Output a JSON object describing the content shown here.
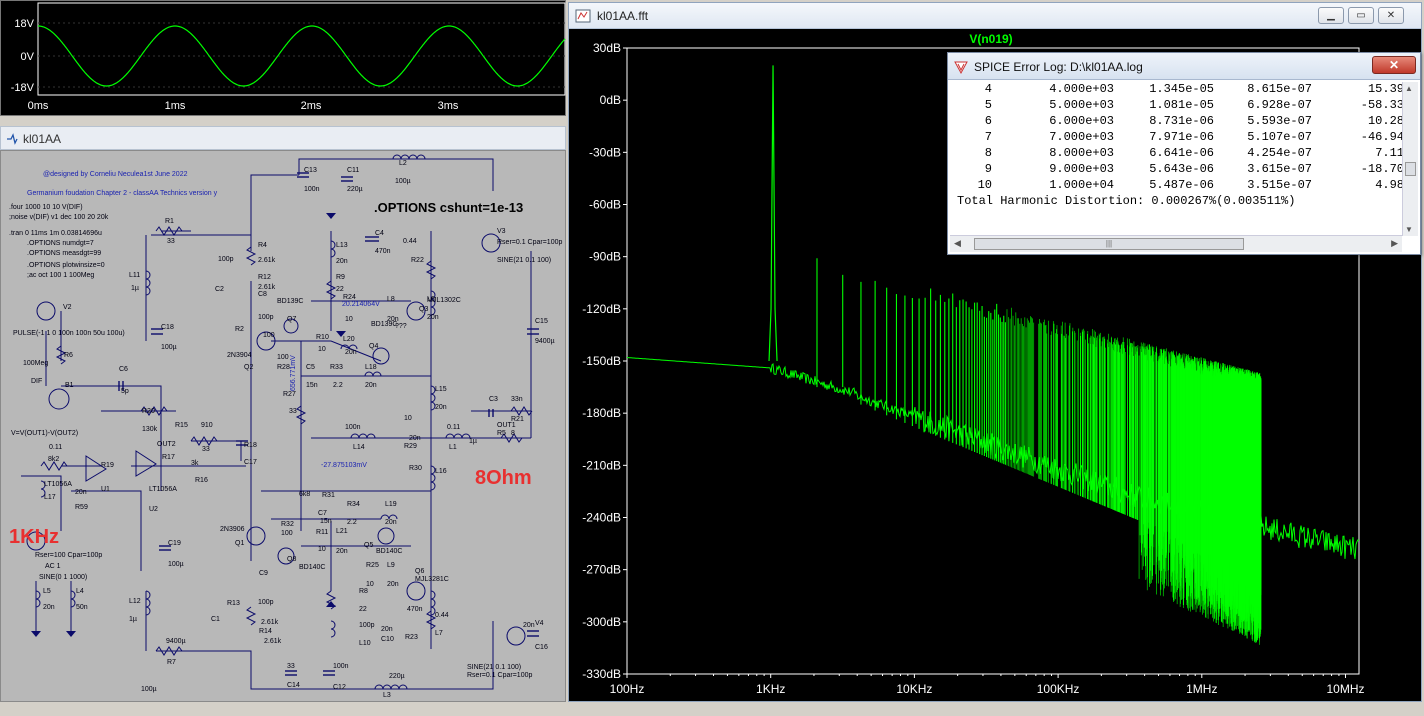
{
  "waveform": {
    "y_labels": [
      "18V",
      "0V",
      "-18V"
    ],
    "x_labels": [
      "0ms",
      "1ms",
      "2ms",
      "3ms"
    ]
  },
  "schematic": {
    "title": "kl01AA",
    "header_lines": [
      "@designed by Corneliu Neculea1st June 2022",
      "Germanium foudation Chapter 2 - classAA Technics version y"
    ],
    "directives": [
      ".four 1000 10 10 V(DIF)",
      ";noise v(DIF) v1 dec 100 20 20k",
      ".tran 0 11ms 1m 0.03814696u",
      ".OPTIONS numdgt=7",
      ".OPTIONS measdgt=99",
      ".OPTIONS plotwinsize=0",
      ";ac oct 100 1 100Meg"
    ],
    "options_big": ".OPTIONS cshunt=1e-13",
    "label_8ohm": "8Ohm",
    "label_1khz": "1KHz",
    "pulse": "PULSE(-1 1 0 100n 100n 50u 100u)",
    "dif_expr": "V=V(OUT1)-V(OUT2)",
    "src_bottom_left": [
      "Rser=100 Cpar=100p",
      "AC 1",
      "SINE(0 1 1000)"
    ],
    "src_v3": [
      "Rser=0.1 Cpar=100p",
      "SINE(21 0.1 100)"
    ],
    "src_v4": [
      "SINE(21 0.1 100)",
      "Rser=0.1 Cpar=100p"
    ],
    "node_voltage_1": "20.214064V",
    "node_voltage_2": "-27.875103mV",
    "node_voltage_3": "656.771mV",
    "labels": [
      "C13",
      "100n",
      "C11",
      "220µ",
      "L2",
      "100µ",
      "R1",
      "33",
      "R4",
      "2.61k",
      "R12",
      "2.61k",
      "L13",
      "20n",
      "C4",
      "470n",
      "0.44",
      "R22",
      "V3",
      "L11",
      "1µ",
      "C2",
      "100p",
      "C8",
      "100p",
      "R9",
      "22",
      "R24",
      "10",
      "L8",
      "20n",
      "L6",
      "20n",
      "MJL1302C",
      "BD139C",
      "BD139C",
      "???",
      "Q3",
      "Q7",
      "V2",
      "C18",
      "100µ",
      "R2",
      "100",
      "Q2",
      "2N3904",
      "R10",
      "10",
      "L20",
      "20n",
      "Q4",
      "C15",
      "9400µ",
      "R6",
      "100Meg",
      "DIF",
      "B1",
      "C6",
      "5p",
      "R28",
      "100",
      "C5",
      "15n",
      "R33",
      "2.2",
      "L18",
      "20n",
      "R27",
      "33",
      "L15",
      "20n",
      "R20",
      "130k",
      "R15",
      "910",
      "C3",
      "33n",
      "R21",
      "10",
      "0.11",
      "L1",
      "1µ",
      "OUT1",
      "R5",
      "8",
      "OUT2",
      "R17",
      "3k",
      "R16",
      "33",
      "R18",
      "C17",
      "100n",
      "L14",
      "20n",
      "R29",
      "0.11",
      "8k2",
      "R19",
      "U1",
      "LT1056A",
      "U2",
      "LT1056A",
      "L17",
      "20n",
      "R59",
      "6k8",
      "R30",
      "L16",
      "R31",
      "C7",
      "15n",
      "R34",
      "2.2",
      "L19",
      "20n",
      "2N3906",
      "R32",
      "100",
      "Q1",
      "R11",
      "10",
      "L21",
      "20n",
      "Q5",
      "BD140C",
      "Q8",
      "BD140C",
      "C19",
      "100µ",
      "C9",
      "100p",
      "R8",
      "22",
      "R25",
      "10",
      "L9",
      "20n",
      "Q6",
      "MJL3281C",
      "L5",
      "20n",
      "L4",
      "50n",
      "L12",
      "1µ",
      "R13",
      "2.61k",
      "R14",
      "2.61k",
      "C1",
      "100p",
      "L10",
      "20n",
      "C10",
      "470n",
      "R23",
      "0.44",
      "L7",
      "20n",
      "V4",
      "C16",
      "9400µ",
      "R7",
      "33",
      "C14",
      "100n",
      "C12",
      "220µ",
      "L3",
      "100µ"
    ]
  },
  "fft": {
    "title": "kl01AA.fft",
    "trace_name": "V(n019)",
    "y_labels": [
      "30dB",
      "0dB",
      "-30dB",
      "-60dB",
      "-90dB",
      "-120dB",
      "-150dB",
      "-180dB",
      "-210dB",
      "-240dB",
      "-270dB",
      "-300dB",
      "-330dB"
    ],
    "x_labels": [
      "100Hz",
      "1KHz",
      "10KHz",
      "100KHz",
      "1MHz",
      "10MHz"
    ],
    "trace_color": "#00ff00"
  },
  "log": {
    "title": "SPICE Error Log: D:\\kl01AA.log",
    "rows": [
      {
        "n": "4",
        "freq": "4.000e+03",
        "mag": "1.345e-05",
        "norm": "8.615e-07",
        "phase": "15.39"
      },
      {
        "n": "5",
        "freq": "5.000e+03",
        "mag": "1.081e-05",
        "norm": "6.928e-07",
        "phase": "-58.33"
      },
      {
        "n": "6",
        "freq": "6.000e+03",
        "mag": "8.731e-06",
        "norm": "5.593e-07",
        "phase": "10.28"
      },
      {
        "n": "7",
        "freq": "7.000e+03",
        "mag": "7.971e-06",
        "norm": "5.107e-07",
        "phase": "-46.94"
      },
      {
        "n": "8",
        "freq": "8.000e+03",
        "mag": "6.641e-06",
        "norm": "4.254e-07",
        "phase": "7.11"
      },
      {
        "n": "9",
        "freq": "9.000e+03",
        "mag": "5.643e-06",
        "norm": "3.615e-07",
        "phase": "-18.70"
      },
      {
        "n": "10",
        "freq": "1.000e+04",
        "mag": "5.487e-06",
        "norm": "3.515e-07",
        "phase": "4.98"
      }
    ],
    "thd": "Total Harmonic Distortion: 0.000267%(0.003511%)"
  }
}
